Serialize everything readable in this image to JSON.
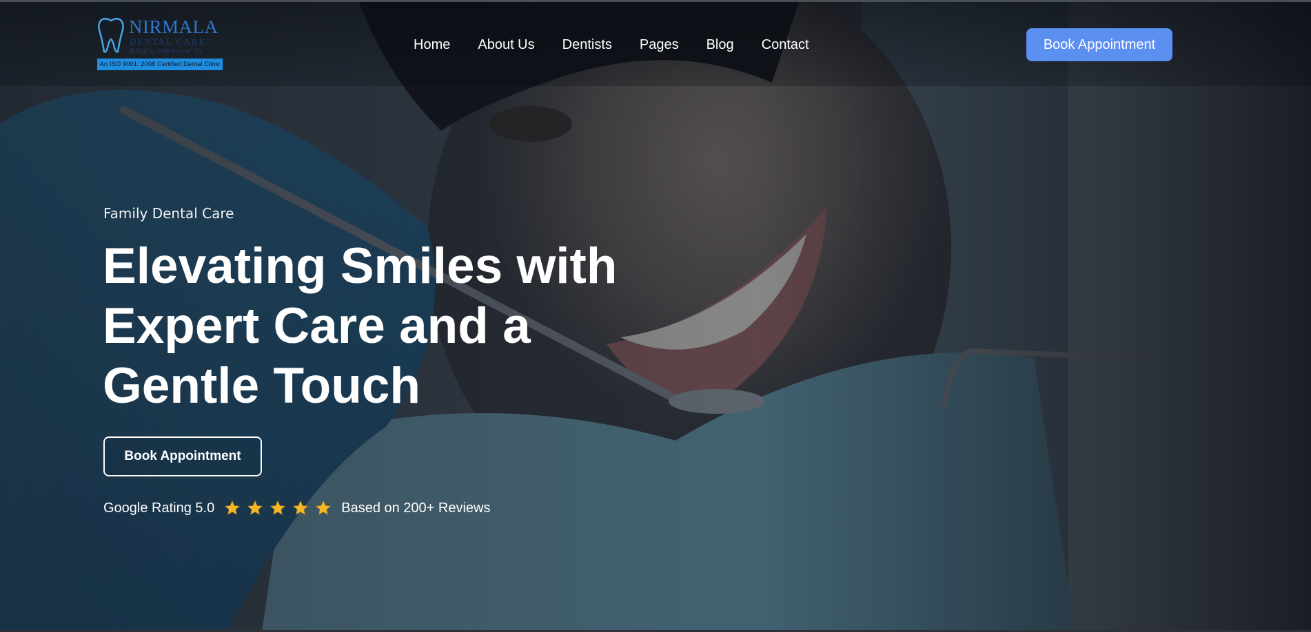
{
  "colors": {
    "accent": "#5b8ff0",
    "star": "#f3b829",
    "logo_blue": "#2f77c8",
    "cert_bar": "#1f8de0"
  },
  "logo": {
    "name": "NIRMALA",
    "subtitle": "DENTAL CARE",
    "tagline": "Bringing smile to your life",
    "certification": "An ISO 9001: 2008 Certified Dental Clinic",
    "icon": "tooth-icon"
  },
  "nav": {
    "items": [
      {
        "label": "Home"
      },
      {
        "label": "About Us"
      },
      {
        "label": "Dentists"
      },
      {
        "label": "Pages"
      },
      {
        "label": "Blog"
      },
      {
        "label": "Contact"
      }
    ]
  },
  "header": {
    "cta_label": "Book Appointment"
  },
  "hero": {
    "eyebrow": "Family Dental Care",
    "headline_lines": [
      "Elevating Smiles with",
      "Expert Care and a",
      "Gentle Touch"
    ],
    "cta_label": "Book Appointment",
    "background": "photo-dentist-patient-smiling"
  },
  "rating": {
    "label": "Google Rating 5.0",
    "stars": 5,
    "star_icon": "star-icon",
    "reviews_text": "Based on 200+ Reviews"
  }
}
